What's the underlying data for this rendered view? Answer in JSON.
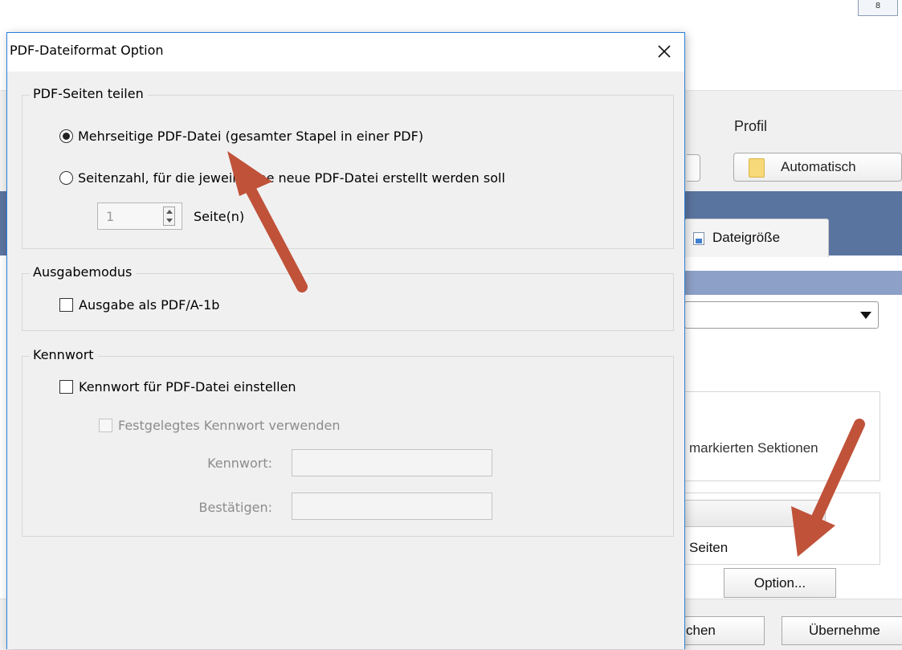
{
  "background_window": {
    "top_button_label": "8",
    "toolbar_label_profil": "Profil",
    "profile_button_label": "Automatisch",
    "tab_label": "Dateigröße",
    "group_text_sektionen": "markierten Sektionen",
    "group_text_seiten": "Seiten",
    "option_button_label": "Option...",
    "footer_button_left_label": "chen",
    "footer_button_right_label": "Übernehme"
  },
  "dialog": {
    "title": "PDF-Dateiformat Option",
    "groups": {
      "split": {
        "label": "PDF-Seiten teilen",
        "radio_multi_label": "Mehrseitige PDF-Datei (gesamter Stapel in einer PDF)",
        "radio_multi_checked": true,
        "radio_pages_label": "Seitenzahl, für die jeweils eine neue PDF-Datei erstellt werden soll",
        "radio_pages_checked": false,
        "pages_value": "1",
        "pages_unit": "Seite(n)"
      },
      "output": {
        "label": "Ausgabemodus",
        "checkbox_pdfa_label": "Ausgabe als PDF/A-1b",
        "checkbox_pdfa_checked": false
      },
      "password": {
        "label": "Kennwort",
        "checkbox_set_label": "Kennwort für PDF-Datei einstellen",
        "checkbox_set_checked": false,
        "checkbox_fixed_label": "Festgelegtes Kennwort verwenden",
        "checkbox_fixed_checked": false,
        "field_password_label": "Kennwort:",
        "field_password_value": "",
        "field_confirm_label": "Bestätigen:",
        "field_confirm_value": ""
      }
    }
  },
  "annotation_color": "#c0523a"
}
